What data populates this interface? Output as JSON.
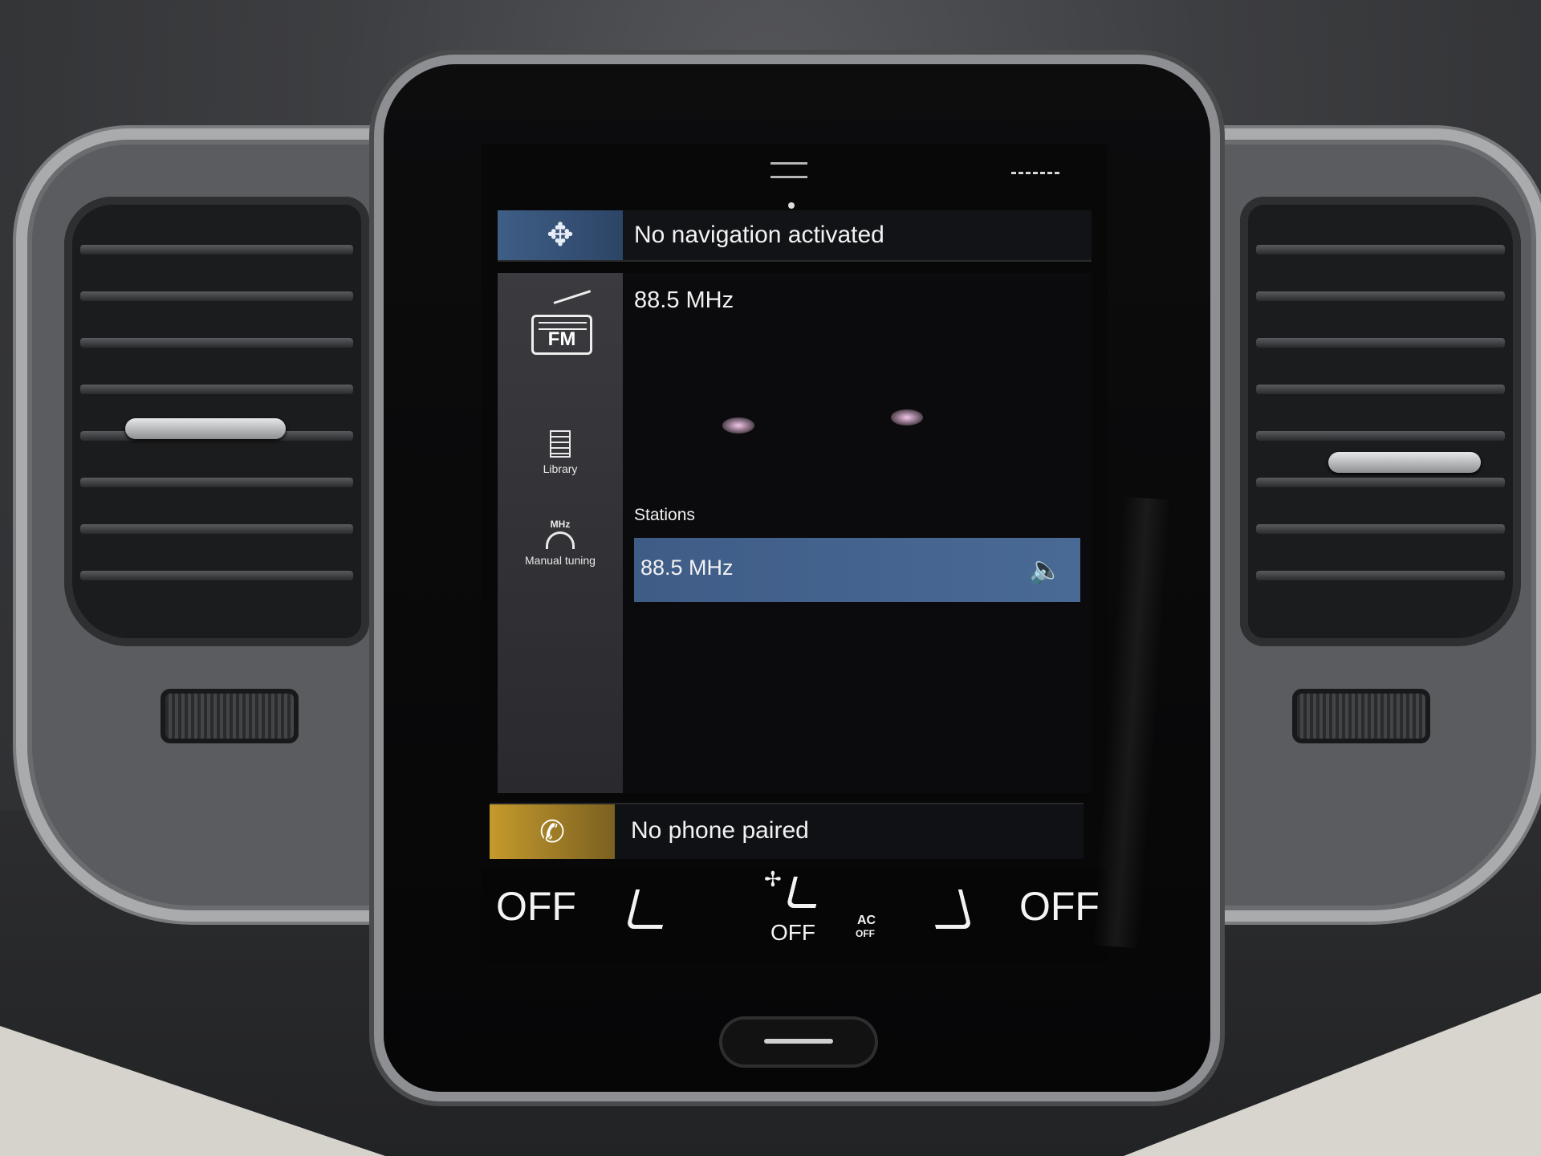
{
  "navigation": {
    "status_text": "No navigation activated",
    "icon": "compass-icon"
  },
  "media": {
    "source_icon": "fm-radio-icon",
    "source_label": "FM",
    "current_frequency": "88.5 MHz",
    "stations_header": "Stations",
    "stations": [
      {
        "label": "88.5 MHz",
        "playing_icon": "speaker-icon"
      }
    ],
    "sidebar": [
      {
        "label": "Library",
        "icon": "library-icon"
      },
      {
        "label": "Manual tuning",
        "icon": "tuning-dial-icon",
        "icon_text": "MHz"
      }
    ]
  },
  "phone": {
    "status_text": "No phone paired",
    "icon": "phone-icon"
  },
  "climate": {
    "left_temp": "OFF",
    "right_temp": "OFF",
    "fan_level": "OFF",
    "ac_label": "AC",
    "ac_state": "OFF"
  },
  "colors": {
    "navigation_accent": "#3f5e86",
    "phone_accent": "#c59a2c",
    "selected_station": "#3e5c86"
  }
}
